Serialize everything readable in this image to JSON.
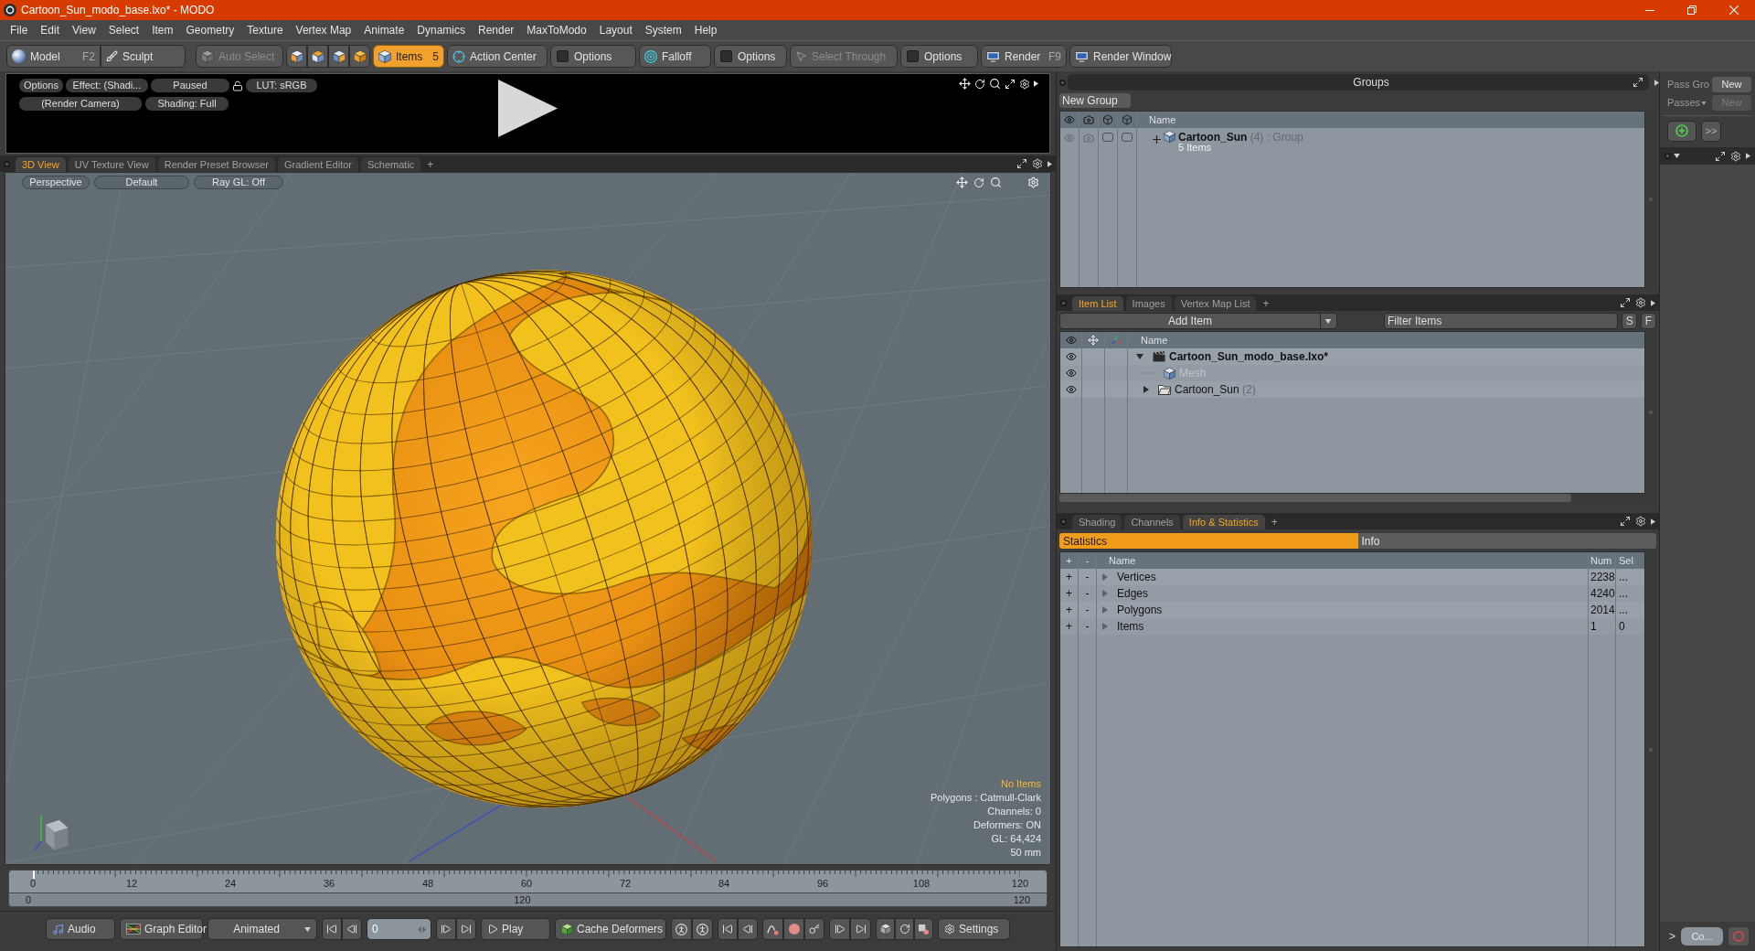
{
  "window": {
    "title": "Cartoon_Sun_modo_base.lxo* - MODO"
  },
  "menu": [
    "File",
    "Edit",
    "View",
    "Select",
    "Item",
    "Geometry",
    "Texture",
    "Vertex Map",
    "Animate",
    "Dynamics",
    "Render",
    "MaxToModo",
    "Layout",
    "System",
    "Help"
  ],
  "toolbar": [
    {
      "items": [
        {
          "kind": "tool",
          "label": "Model",
          "shortcut": "F2"
        },
        {
          "kind": "tool",
          "label": "Sculpt"
        }
      ]
    },
    {
      "items": [
        {
          "kind": "tool",
          "label": "Auto Select",
          "disabled": true
        }
      ]
    },
    {
      "items": [
        {
          "kind": "mode",
          "selected": false
        },
        {
          "kind": "mode",
          "selected": false
        },
        {
          "kind": "mode",
          "selected": false
        },
        {
          "kind": "mode",
          "selected": false
        }
      ]
    },
    {
      "items": [
        {
          "kind": "tool",
          "label": "Items",
          "badge": "5",
          "selected": true
        }
      ]
    },
    {
      "items": [
        {
          "kind": "tool",
          "label": "Action Center"
        }
      ]
    },
    {
      "items": [
        {
          "kind": "option",
          "label": "Options",
          "checked": false
        }
      ]
    },
    {
      "items": [
        {
          "kind": "tool",
          "label": "Falloff"
        }
      ]
    },
    {
      "items": [
        {
          "kind": "option",
          "label": "Options",
          "checked": false
        }
      ]
    },
    {
      "items": [
        {
          "kind": "tool",
          "label": "Select Through",
          "disabled": true
        }
      ]
    },
    {
      "items": [
        {
          "kind": "option",
          "label": "Options",
          "checked": false
        }
      ]
    },
    {
      "items": [
        {
          "kind": "tool",
          "label": "Render",
          "shortcut": "F9"
        }
      ]
    },
    {
      "items": [
        {
          "kind": "tool",
          "label": "Render Window"
        }
      ]
    }
  ],
  "render_preview": {
    "row_1": [
      {
        "kind": "button",
        "label": "Options"
      },
      {
        "kind": "button",
        "label": "Effect: (Shadi..."
      },
      {
        "kind": "button",
        "label": "Paused"
      },
      {
        "kind": "lock",
        "locked": false
      },
      {
        "kind": "button",
        "label": "LUT: sRGB"
      }
    ],
    "row_2": [
      {
        "kind": "button",
        "label": "(Render Camera)"
      },
      {
        "kind": "button",
        "label": "Shading: Full"
      }
    ]
  },
  "viewport_tabs": {
    "tabs": [
      {
        "label": "3D View",
        "selected": true
      },
      {
        "label": "UV Texture View",
        "selected": false
      },
      {
        "label": "Render Preset Browser",
        "selected": false
      },
      {
        "label": "Gradient Editor",
        "selected": false
      },
      {
        "label": "Schematic",
        "selected": false
      }
    ],
    "add": "+"
  },
  "viewport": {
    "controls": [
      "Perspective",
      "Default",
      "Ray GL: Off"
    ],
    "status": "No Items",
    "info": [
      "Polygons : Catmull-Clark",
      "Channels: 0",
      "Deformers: ON",
      "GL: 64,424",
      "50 mm"
    ]
  },
  "timeline": {
    "ticks": [
      "0",
      "12",
      "24",
      "36",
      "48",
      "60",
      "72",
      "84",
      "96",
      "108",
      "120"
    ],
    "range": [
      "0",
      "120",
      "120"
    ],
    "playhead": {
      "level": 0
    }
  },
  "bottom_toolbar": [
    {
      "items": [
        {
          "kind": "button",
          "label": "Audio"
        }
      ]
    },
    {
      "items": [
        {
          "kind": "button",
          "label": "Graph Editor"
        }
      ]
    },
    {
      "items": [
        {
          "kind": "dropdown",
          "label": "Animated"
        }
      ]
    },
    {
      "items": [
        {
          "kind": "icon"
        },
        {
          "kind": "icon"
        }
      ]
    },
    {
      "items": [
        {
          "kind": "field",
          "value": "0"
        }
      ]
    },
    {
      "items": [
        {
          "kind": "icon"
        },
        {
          "kind": "icon"
        }
      ]
    },
    {
      "items": [
        {
          "kind": "button",
          "label": "Play"
        }
      ]
    },
    {
      "items": [
        {
          "kind": "button",
          "label": "Cache Deformers"
        }
      ]
    },
    {
      "items": [
        {
          "kind": "icon"
        },
        {
          "kind": "icon"
        }
      ]
    },
    {
      "items": [
        {
          "kind": "icon"
        },
        {
          "kind": "icon"
        }
      ]
    },
    {
      "items": [
        {
          "kind": "icon"
        },
        {
          "kind": "icon"
        },
        {
          "kind": "icon"
        }
      ]
    },
    {
      "items": [
        {
          "kind": "icon"
        },
        {
          "kind": "icon"
        }
      ]
    },
    {
      "items": [
        {
          "kind": "icon"
        },
        {
          "kind": "icon"
        },
        {
          "kind": "icon"
        }
      ]
    },
    {
      "items": [
        {
          "kind": "button",
          "label": "Settings"
        }
      ]
    }
  ],
  "groups_panel": {
    "title": "Groups",
    "new_button": "New Group",
    "column": "Name",
    "rows": [
      {
        "name": "Cartoon_Sun",
        "count": "(4)",
        "type": ": Group",
        "detail": "5 Items",
        "expanded": false
      }
    ]
  },
  "item_list_tabs": {
    "tabs": [
      {
        "label": "Item List",
        "selected": true
      },
      {
        "label": "Images",
        "selected": false
      },
      {
        "label": "Vertex Map List",
        "selected": false
      }
    ],
    "add": "+"
  },
  "item_list": {
    "add_button": "Add Item",
    "filter": {
      "placeholder": "Filter Items"
    },
    "filter_buttons": [
      "S",
      "F"
    ],
    "column": "Name",
    "items": [
      {
        "kind": "scene",
        "name": "Cartoon_Sun_modo_base.lxo*",
        "expanded": true,
        "children": [
          {
            "kind": "mesh",
            "name": "Mesh",
            "disabled": true
          },
          {
            "kind": "group",
            "name": "Cartoon_Sun",
            "count": "(2)",
            "expanded": false
          }
        ]
      }
    ]
  },
  "info_tabs": {
    "tabs": [
      {
        "label": "Shading",
        "selected": false
      },
      {
        "label": "Channels",
        "selected": false
      },
      {
        "label": "Info & Statistics",
        "selected": true
      }
    ],
    "add": "+"
  },
  "statistics_tabs": [
    {
      "label": "Statistics",
      "selected": true
    },
    {
      "label": "Info",
      "selected": false
    }
  ],
  "statistics": {
    "columns": [
      "+",
      "-",
      "Name",
      "Num",
      "Sel"
    ],
    "rows": [
      {
        "add": "+",
        "remove": "-",
        "name": "Vertices",
        "num": "2238",
        "sel": "...",
        "expanded": false
      },
      {
        "add": "+",
        "remove": "-",
        "name": "Edges",
        "num": "4240",
        "sel": "...",
        "expanded": false
      },
      {
        "add": "+",
        "remove": "-",
        "name": "Polygons",
        "num": "2014",
        "sel": "...",
        "expanded": false
      },
      {
        "add": "+",
        "remove": "-",
        "name": "Items",
        "num": "1",
        "sel": "0",
        "expanded": false
      }
    ]
  },
  "passes": {
    "rows": [
      {
        "label": "Pass Gro",
        "button": "New",
        "disabled": false
      },
      {
        "label": "Passes",
        "button": "New",
        "disabled": true
      }
    ],
    "more_button": ">>",
    "prompt": ">",
    "command_button": "Co..."
  }
}
